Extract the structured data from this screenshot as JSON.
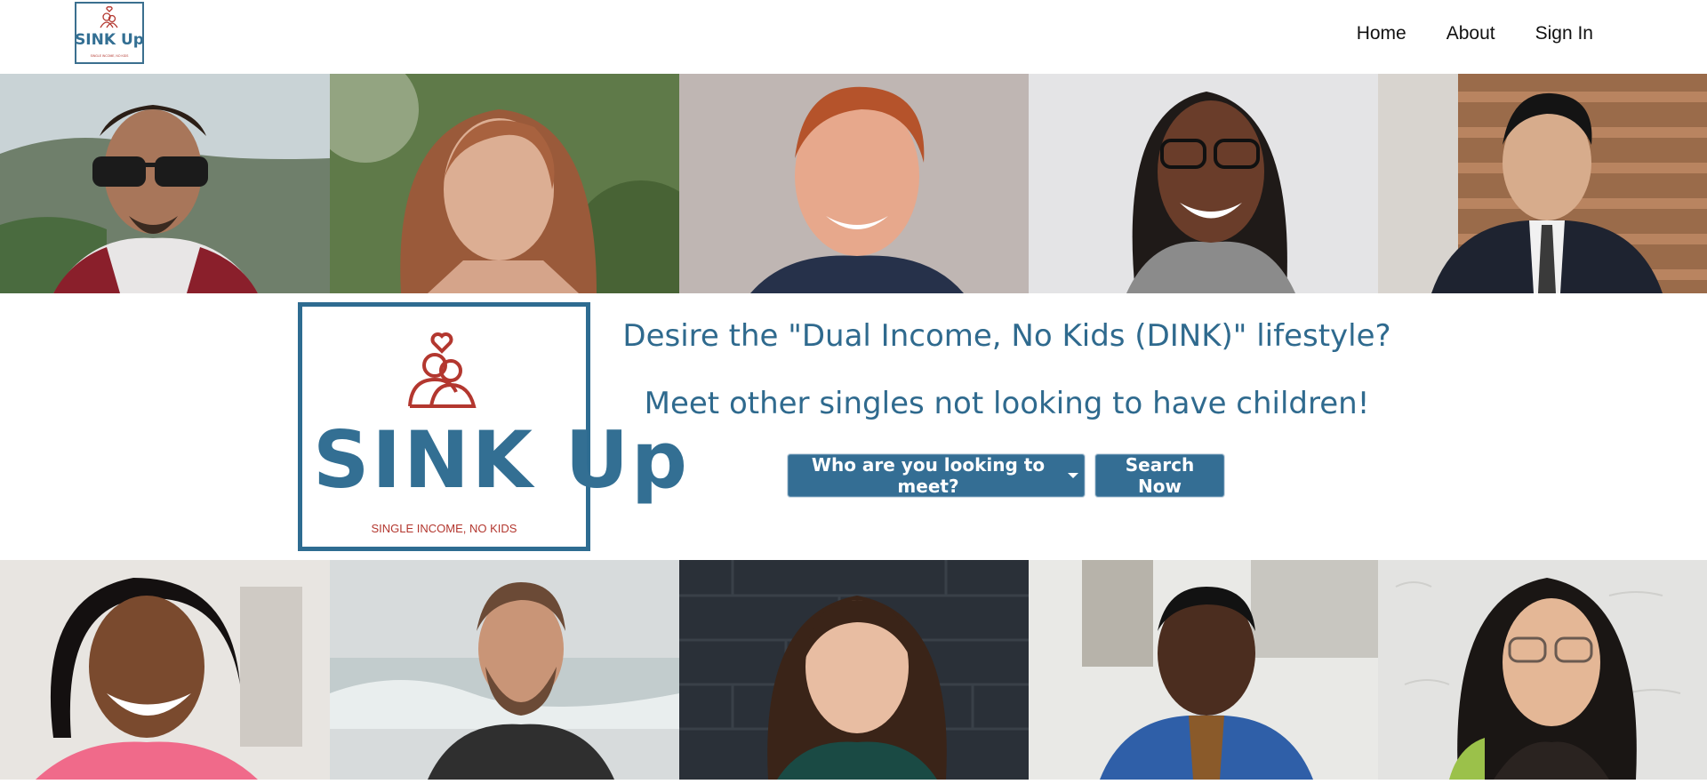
{
  "nav": {
    "logo": {
      "wordmark": "SINK Up",
      "tagline": "SINGLE INCOME, NO KIDS",
      "icon": "couple-heart-icon"
    },
    "links": [
      "Home",
      "About",
      "Sign In"
    ]
  },
  "hero": {
    "logo": {
      "wordmark": "SINK Up",
      "tagline": "SINGLE INCOME, NO KIDS",
      "icon": "couple-heart-icon"
    },
    "line1": "Desire the \"Dual Income, No Kids (DINK)\" lifestyle?",
    "line2": "Meet other singles not looking to have children!",
    "dropdown_label": "Who are you looking to meet?",
    "search_label": "Search Now"
  },
  "colors": {
    "brand_blue": "#346e94",
    "brand_red": "#b3372f",
    "nav_text": "#111111",
    "background": "#ffffff"
  },
  "photos": {
    "top_row": [
      "portrait-photo",
      "portrait-photo",
      "portrait-photo",
      "portrait-photo",
      "portrait-photo"
    ],
    "bottom_row": [
      "portrait-photo",
      "portrait-photo",
      "portrait-photo",
      "portrait-photo",
      "portrait-photo"
    ]
  }
}
